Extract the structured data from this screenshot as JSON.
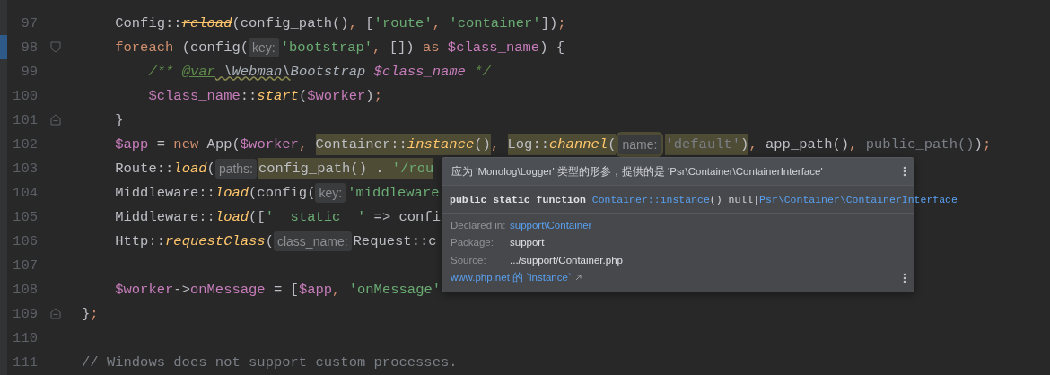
{
  "editor": {
    "lines": [
      {
        "number": "97",
        "marked": false,
        "fold_start": false,
        "fold_end": false,
        "tokens": [
          {
            "text": "    Config::",
            "kind": "plain",
            "highlighted": false
          },
          {
            "text": "reload",
            "kind": "deprecated",
            "highlighted": false
          },
          {
            "text": "(config_path()",
            "kind": "plain",
            "highlighted": false
          },
          {
            "text": ", ",
            "kind": "punct",
            "highlighted": false
          },
          {
            "text": "[",
            "kind": "plain",
            "highlighted": false
          },
          {
            "text": "'route'",
            "kind": "string",
            "highlighted": false
          },
          {
            "text": ", ",
            "kind": "punct",
            "highlighted": false
          },
          {
            "text": "'container'",
            "kind": "string",
            "highlighted": false
          },
          {
            "text": "])",
            "kind": "plain",
            "highlighted": false
          },
          {
            "text": ";",
            "kind": "punct",
            "highlighted": false
          }
        ]
      },
      {
        "number": "98",
        "marked": true,
        "fold_start": true,
        "fold_end": false,
        "tokens": [
          {
            "text": "    foreach",
            "kind": "keyword",
            "highlighted": false
          },
          {
            "text": " (config(",
            "kind": "plain",
            "highlighted": false
          },
          {
            "text": "key:",
            "kind": "hint",
            "highlighted": false
          },
          {
            "text": "'bootstrap'",
            "kind": "string",
            "highlighted": false
          },
          {
            "text": ", ",
            "kind": "punct",
            "highlighted": false
          },
          {
            "text": "[]) ",
            "kind": "plain",
            "highlighted": false
          },
          {
            "text": "as",
            "kind": "keyword",
            "highlighted": false
          },
          {
            "text": " $class_name",
            "kind": "var",
            "highlighted": false
          },
          {
            "text": ") {",
            "kind": "plain",
            "highlighted": false
          }
        ]
      },
      {
        "number": "99",
        "marked": false,
        "fold_start": false,
        "fold_end": false,
        "tokens": [
          {
            "text": "        /** ",
            "kind": "doc",
            "highlighted": false
          },
          {
            "text": "@var",
            "kind": "doctag",
            "highlighted": false
          },
          {
            "text": " \\Webman\\",
            "kind": "doctypewarn",
            "highlighted": false
          },
          {
            "text": "Bootstrap ",
            "kind": "doctype",
            "highlighted": false
          },
          {
            "text": "$class_name",
            "kind": "docvar",
            "highlighted": false
          },
          {
            "text": " */",
            "kind": "doc",
            "highlighted": false
          }
        ]
      },
      {
        "number": "100",
        "marked": false,
        "fold_start": false,
        "fold_end": false,
        "tokens": [
          {
            "text": "        $class_name",
            "kind": "var",
            "highlighted": false
          },
          {
            "text": "::",
            "kind": "plain",
            "highlighted": false
          },
          {
            "text": "start",
            "kind": "call",
            "highlighted": false
          },
          {
            "text": "(",
            "kind": "plain",
            "highlighted": false
          },
          {
            "text": "$worker",
            "kind": "var",
            "highlighted": false
          },
          {
            "text": ")",
            "kind": "plain",
            "highlighted": false
          },
          {
            "text": ";",
            "kind": "punct",
            "highlighted": false
          }
        ]
      },
      {
        "number": "101",
        "marked": false,
        "fold_start": false,
        "fold_end": true,
        "tokens": [
          {
            "text": "    }",
            "kind": "plain",
            "highlighted": false
          }
        ]
      },
      {
        "number": "102",
        "marked": false,
        "fold_start": false,
        "fold_end": false,
        "tokens": [
          {
            "text": "    $app",
            "kind": "var",
            "highlighted": false
          },
          {
            "text": " = ",
            "kind": "plain",
            "highlighted": false
          },
          {
            "text": "new",
            "kind": "keyword",
            "highlighted": false
          },
          {
            "text": " App(",
            "kind": "plain",
            "highlighted": false
          },
          {
            "text": "$worker",
            "kind": "var",
            "highlighted": false
          },
          {
            "text": ", ",
            "kind": "punct",
            "highlighted": false
          },
          {
            "text": "Container::",
            "kind": "plain",
            "highlighted": true
          },
          {
            "text": "instance",
            "kind": "call",
            "highlighted": true
          },
          {
            "text": "()",
            "kind": "plain",
            "highlighted": true
          },
          {
            "text": ", ",
            "kind": "punct",
            "highlighted": false
          },
          {
            "text": "Log::",
            "kind": "plain",
            "highlighted": true
          },
          {
            "text": "channel",
            "kind": "call",
            "highlighted": true
          },
          {
            "text": "(",
            "kind": "plain",
            "highlighted": true
          },
          {
            "text": "name:",
            "kind": "hint",
            "highlighted": true
          },
          {
            "text": "'default'",
            "kind": "dim",
            "highlighted": true
          },
          {
            "text": ")",
            "kind": "plain",
            "highlighted": true
          },
          {
            "text": ", ",
            "kind": "punct",
            "highlighted": false
          },
          {
            "text": "app_path()",
            "kind": "plain",
            "highlighted": false
          },
          {
            "text": ", ",
            "kind": "punct",
            "highlighted": false
          },
          {
            "text": "public_path()",
            "kind": "dim",
            "highlighted": false
          },
          {
            "text": ")",
            "kind": "plain",
            "highlighted": false
          },
          {
            "text": ";",
            "kind": "punct",
            "highlighted": false
          }
        ]
      },
      {
        "number": "103",
        "marked": false,
        "fold_start": false,
        "fold_end": false,
        "tokens": [
          {
            "text": "    Route::",
            "kind": "plain",
            "highlighted": false
          },
          {
            "text": "load",
            "kind": "call",
            "highlighted": false
          },
          {
            "text": "(",
            "kind": "plain",
            "highlighted": false
          },
          {
            "text": "paths:",
            "kind": "hint",
            "highlighted": false
          },
          {
            "text": "config_path() . ",
            "kind": "plain",
            "highlighted": true
          },
          {
            "text": "'/rou",
            "kind": "string",
            "highlighted": true
          }
        ]
      },
      {
        "number": "104",
        "marked": false,
        "fold_start": false,
        "fold_end": false,
        "tokens": [
          {
            "text": "    Middleware::",
            "kind": "plain",
            "highlighted": false
          },
          {
            "text": "load",
            "kind": "call",
            "highlighted": false
          },
          {
            "text": "(config(",
            "kind": "plain",
            "highlighted": false
          },
          {
            "text": "key:",
            "kind": "hint",
            "highlighted": false
          },
          {
            "text": "'middleware",
            "kind": "string",
            "highlighted": false
          }
        ]
      },
      {
        "number": "105",
        "marked": false,
        "fold_start": false,
        "fold_end": false,
        "tokens": [
          {
            "text": "    Middleware::",
            "kind": "plain",
            "highlighted": false
          },
          {
            "text": "load",
            "kind": "call",
            "highlighted": false
          },
          {
            "text": "([",
            "kind": "plain",
            "highlighted": false
          },
          {
            "text": "'__static__'",
            "kind": "string",
            "highlighted": false
          },
          {
            "text": " => confi",
            "kind": "plain",
            "highlighted": false
          }
        ]
      },
      {
        "number": "106",
        "marked": false,
        "fold_start": false,
        "fold_end": false,
        "tokens": [
          {
            "text": "    Http::",
            "kind": "plain",
            "highlighted": false
          },
          {
            "text": "requestClass",
            "kind": "call",
            "highlighted": false
          },
          {
            "text": "(",
            "kind": "plain",
            "highlighted": false
          },
          {
            "text": "class_name:",
            "kind": "hint",
            "highlighted": false
          },
          {
            "text": "Request::c",
            "kind": "plain",
            "highlighted": false
          }
        ]
      },
      {
        "number": "107",
        "marked": false,
        "fold_start": false,
        "fold_end": false
      },
      {
        "number": "108",
        "marked": false,
        "fold_start": false,
        "fold_end": false,
        "tokens": [
          {
            "text": "    $worker",
            "kind": "var",
            "highlighted": false
          },
          {
            "text": "->",
            "kind": "plain",
            "highlighted": false
          },
          {
            "text": "onMessage",
            "kind": "var",
            "highlighted": false
          },
          {
            "text": " = [",
            "kind": "plain",
            "highlighted": false
          },
          {
            "text": "$app",
            "kind": "var",
            "highlighted": false
          },
          {
            "text": ", ",
            "kind": "punct",
            "highlighted": false
          },
          {
            "text": "'onMessage'",
            "kind": "string",
            "highlighted": false
          }
        ]
      },
      {
        "number": "109",
        "marked": false,
        "fold_start": false,
        "fold_end": true,
        "tokens": [
          {
            "text": "}",
            "kind": "plain",
            "highlighted": false
          },
          {
            "text": ";",
            "kind": "punct",
            "highlighted": false
          }
        ]
      },
      {
        "number": "110",
        "marked": false,
        "fold_start": false,
        "fold_end": false
      },
      {
        "number": "111",
        "marked": false,
        "fold_start": false,
        "fold_end": false,
        "tokens": [
          {
            "text": "// Windows does not support custom processes.",
            "kind": "comment",
            "highlighted": false
          }
        ]
      }
    ]
  },
  "popup": {
    "message": "应为 'Monolog\\Logger' 类型的形参，提供的是 'Psr\\Container\\ContainerInterface'",
    "signature": [
      {
        "text": "public static function ",
        "kind": "keyword"
      },
      {
        "text": "Container::instance",
        "kind": "link"
      },
      {
        "text": "() null|",
        "kind": "plain"
      },
      {
        "text": "Psr\\Container\\ContainerInterface",
        "kind": "link"
      }
    ],
    "details": [
      {
        "label": "Declared in:",
        "value": "support\\Container",
        "kind": "link"
      },
      {
        "label": "Package:",
        "value": "support",
        "kind": "text"
      },
      {
        "label": "Source:",
        "value": ".../support/Container.php",
        "kind": "text"
      }
    ],
    "external_link": "www.php.net 的 `instance`"
  }
}
